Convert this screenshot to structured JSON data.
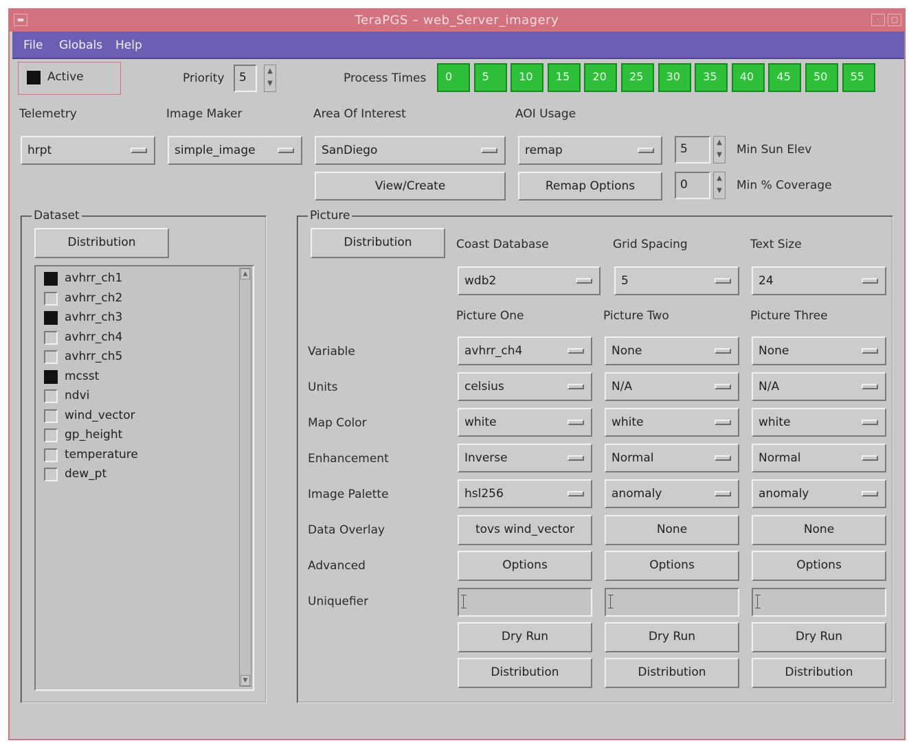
{
  "window": {
    "title": "TeraPGS – web_Server_imagery"
  },
  "menu": {
    "items": [
      "File",
      "Globals",
      "Help"
    ]
  },
  "header": {
    "active_label": "Active",
    "active_checked": true,
    "priority_label": "Priority",
    "priority_value": "5",
    "process_times_label": "Process Times",
    "process_times": [
      "0",
      "5",
      "10",
      "15",
      "20",
      "25",
      "30",
      "35",
      "40",
      "45",
      "50",
      "55"
    ],
    "process_times_color": "#2fbf3a"
  },
  "config": {
    "telemetry_label": "Telemetry",
    "telemetry_value": "hrpt",
    "image_maker_label": "Image Maker",
    "image_maker_value": "simple_image",
    "aoi_label": "Area Of Interest",
    "aoi_value": "SanDiego",
    "aoi_usage_label": "AOI Usage",
    "aoi_usage_value": "remap",
    "min_sun_elev_value": "5",
    "min_sun_elev_label": "Min Sun Elev",
    "min_coverage_value": "0",
    "min_coverage_label": "Min % Coverage",
    "view_create_label": "View/Create",
    "remap_options_label": "Remap Options"
  },
  "dataset": {
    "title": "Dataset",
    "distribution_label": "Distribution",
    "items": [
      {
        "label": "avhrr_ch1",
        "checked": true
      },
      {
        "label": "avhrr_ch2",
        "checked": false
      },
      {
        "label": "avhrr_ch3",
        "checked": true
      },
      {
        "label": "avhrr_ch4",
        "checked": false
      },
      {
        "label": "avhrr_ch5",
        "checked": false
      },
      {
        "label": "mcsst",
        "checked": true
      },
      {
        "label": "ndvi",
        "checked": false
      },
      {
        "label": "wind_vector",
        "checked": false
      },
      {
        "label": "gp_height",
        "checked": false
      },
      {
        "label": "temperature",
        "checked": false
      },
      {
        "label": "dew_pt",
        "checked": false
      }
    ]
  },
  "picture": {
    "title": "Picture",
    "distribution_label": "Distribution",
    "coast_db_label": "Coast Database",
    "coast_db_value": "wdb2",
    "grid_spacing_label": "Grid Spacing",
    "grid_spacing_value": "5",
    "text_size_label": "Text Size",
    "text_size_value": "24",
    "col_headers": [
      "Picture One",
      "Picture Two",
      "Picture Three"
    ],
    "row_labels": {
      "variable": "Variable",
      "units": "Units",
      "map_color": "Map Color",
      "enhancement": "Enhancement",
      "image_palette": "Image Palette",
      "data_overlay": "Data Overlay",
      "advanced": "Advanced",
      "uniquefier": "Uniquefier"
    },
    "columns": [
      {
        "variable": "avhrr_ch4",
        "units": "celsius",
        "map_color": "white",
        "enhancement": "Inverse",
        "image_palette": "hsl256",
        "data_overlay": "tovs wind_vector",
        "advanced": "Options",
        "uniquefier": "",
        "dry_run": "Dry Run",
        "distribution": "Distribution"
      },
      {
        "variable": "None",
        "units": "N/A",
        "map_color": "white",
        "enhancement": "Normal",
        "image_palette": "anomaly",
        "data_overlay": "None",
        "advanced": "Options",
        "uniquefier": "",
        "dry_run": "Dry Run",
        "distribution": "Distribution"
      },
      {
        "variable": "None",
        "units": "N/A",
        "map_color": "white",
        "enhancement": "Normal",
        "image_palette": "anomaly",
        "data_overlay": "None",
        "advanced": "Options",
        "uniquefier": "",
        "dry_run": "Dry Run",
        "distribution": "Distribution"
      }
    ]
  }
}
